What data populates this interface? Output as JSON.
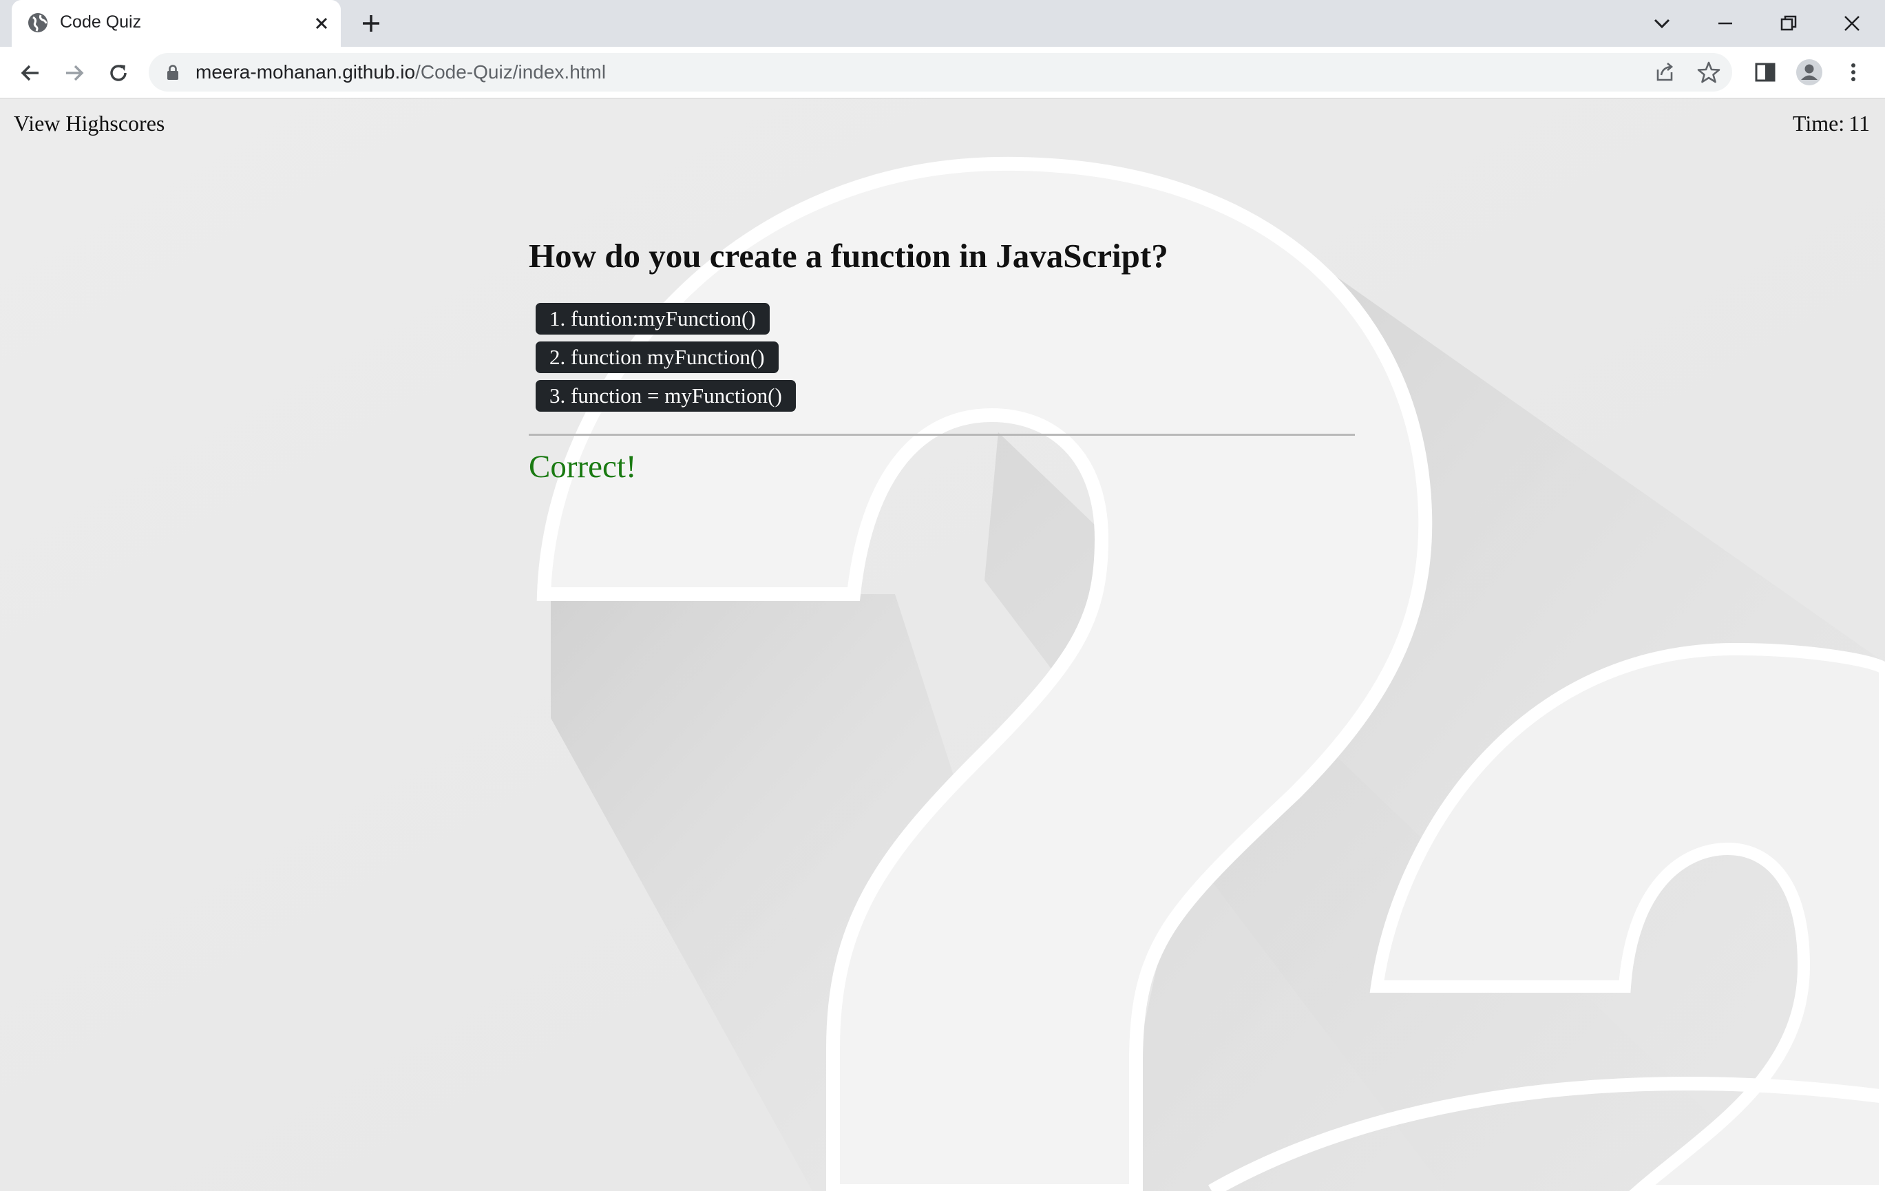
{
  "browser": {
    "tab_title": "Code Quiz",
    "url_domain": "meera-mohanan.github.io",
    "url_path": "/Code-Quiz/index.html"
  },
  "header": {
    "highscores_label": "View Highscores",
    "timer_label": "Time:",
    "timer_value": "11"
  },
  "quiz": {
    "question": "How do you create a function in JavaScript?",
    "choices": [
      "1. funtion:myFunction()",
      "2. function myFunction()",
      "3. function = myFunction()"
    ],
    "feedback": "Correct!"
  },
  "colors": {
    "button_bg": "#212529",
    "feedback_green": "#1a7a12",
    "page_bg": "#ebebeb"
  }
}
